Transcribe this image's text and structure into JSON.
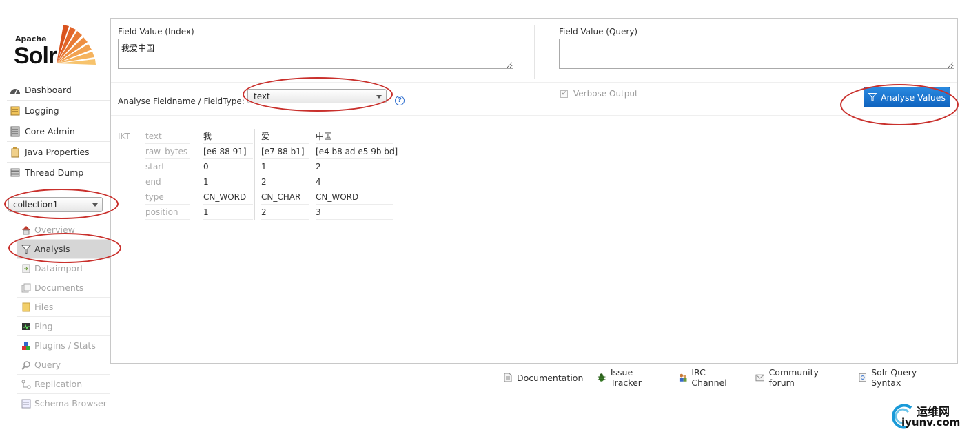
{
  "logo": {
    "apache": "Apache",
    "solr": "Solr"
  },
  "nav": {
    "items": [
      {
        "label": "Dashboard",
        "icon": "dashboard-icon"
      },
      {
        "label": "Logging",
        "icon": "logging-icon"
      },
      {
        "label": "Core Admin",
        "icon": "core-admin-icon"
      },
      {
        "label": "Java Properties",
        "icon": "java-icon"
      },
      {
        "label": "Thread Dump",
        "icon": "thread-dump-icon"
      }
    ]
  },
  "core_selector": {
    "value": "collection1"
  },
  "core_nav": {
    "items": [
      {
        "label": "Overview",
        "icon": "home-icon"
      },
      {
        "label": "Analysis",
        "icon": "funnel-icon",
        "active": true
      },
      {
        "label": "Dataimport",
        "icon": "dataimport-icon"
      },
      {
        "label": "Documents",
        "icon": "documents-icon"
      },
      {
        "label": "Files",
        "icon": "folder-icon"
      },
      {
        "label": "Ping",
        "icon": "ping-icon"
      },
      {
        "label": "Plugins / Stats",
        "icon": "plugins-icon"
      },
      {
        "label": "Query",
        "icon": "magnifier-icon"
      },
      {
        "label": "Replication",
        "icon": "replication-icon"
      },
      {
        "label": "Schema Browser",
        "icon": "schema-icon"
      }
    ]
  },
  "analysis": {
    "index_label": "Field Value (Index)",
    "index_value": "我爱中国",
    "query_label": "Field Value (Query)",
    "query_value": "",
    "fieldtype_label": "Analyse Fieldname / FieldType:",
    "fieldtype_value": "text",
    "help": "?",
    "verbose_label": "Verbose Output",
    "verbose_checked": true,
    "analyse_button": "Analyse Values"
  },
  "result": {
    "analyzer": "IKT",
    "row_labels": [
      "text",
      "raw_bytes",
      "start",
      "end",
      "type",
      "position"
    ],
    "tokens": [
      {
        "text": "我",
        "raw_bytes": "[e6 88 91]",
        "start": "0",
        "end": "1",
        "type": "CN_WORD",
        "position": "1"
      },
      {
        "text": "爱",
        "raw_bytes": "[e7 88 b1]",
        "start": "1",
        "end": "2",
        "type": "CN_CHAR",
        "position": "2"
      },
      {
        "text": "中国",
        "raw_bytes": "[e4 b8 ad e5 9b bd]",
        "start": "2",
        "end": "4",
        "type": "CN_WORD",
        "position": "3"
      }
    ]
  },
  "footer": {
    "links": [
      {
        "label": "Documentation",
        "icon": "document-icon"
      },
      {
        "label": "Issue Tracker",
        "icon": "bug-icon"
      },
      {
        "label": "IRC Channel",
        "icon": "users-icon"
      },
      {
        "label": "Community forum",
        "icon": "mail-icon"
      },
      {
        "label": "Solr Query Syntax",
        "icon": "query-syntax-icon"
      }
    ]
  },
  "watermark": {
    "cn": "运维网",
    "en": "iyunv.com"
  },
  "colors": {
    "accent": "#1a73d0",
    "annotation": "#c9302c",
    "active_bg": "#d6d6d6"
  }
}
